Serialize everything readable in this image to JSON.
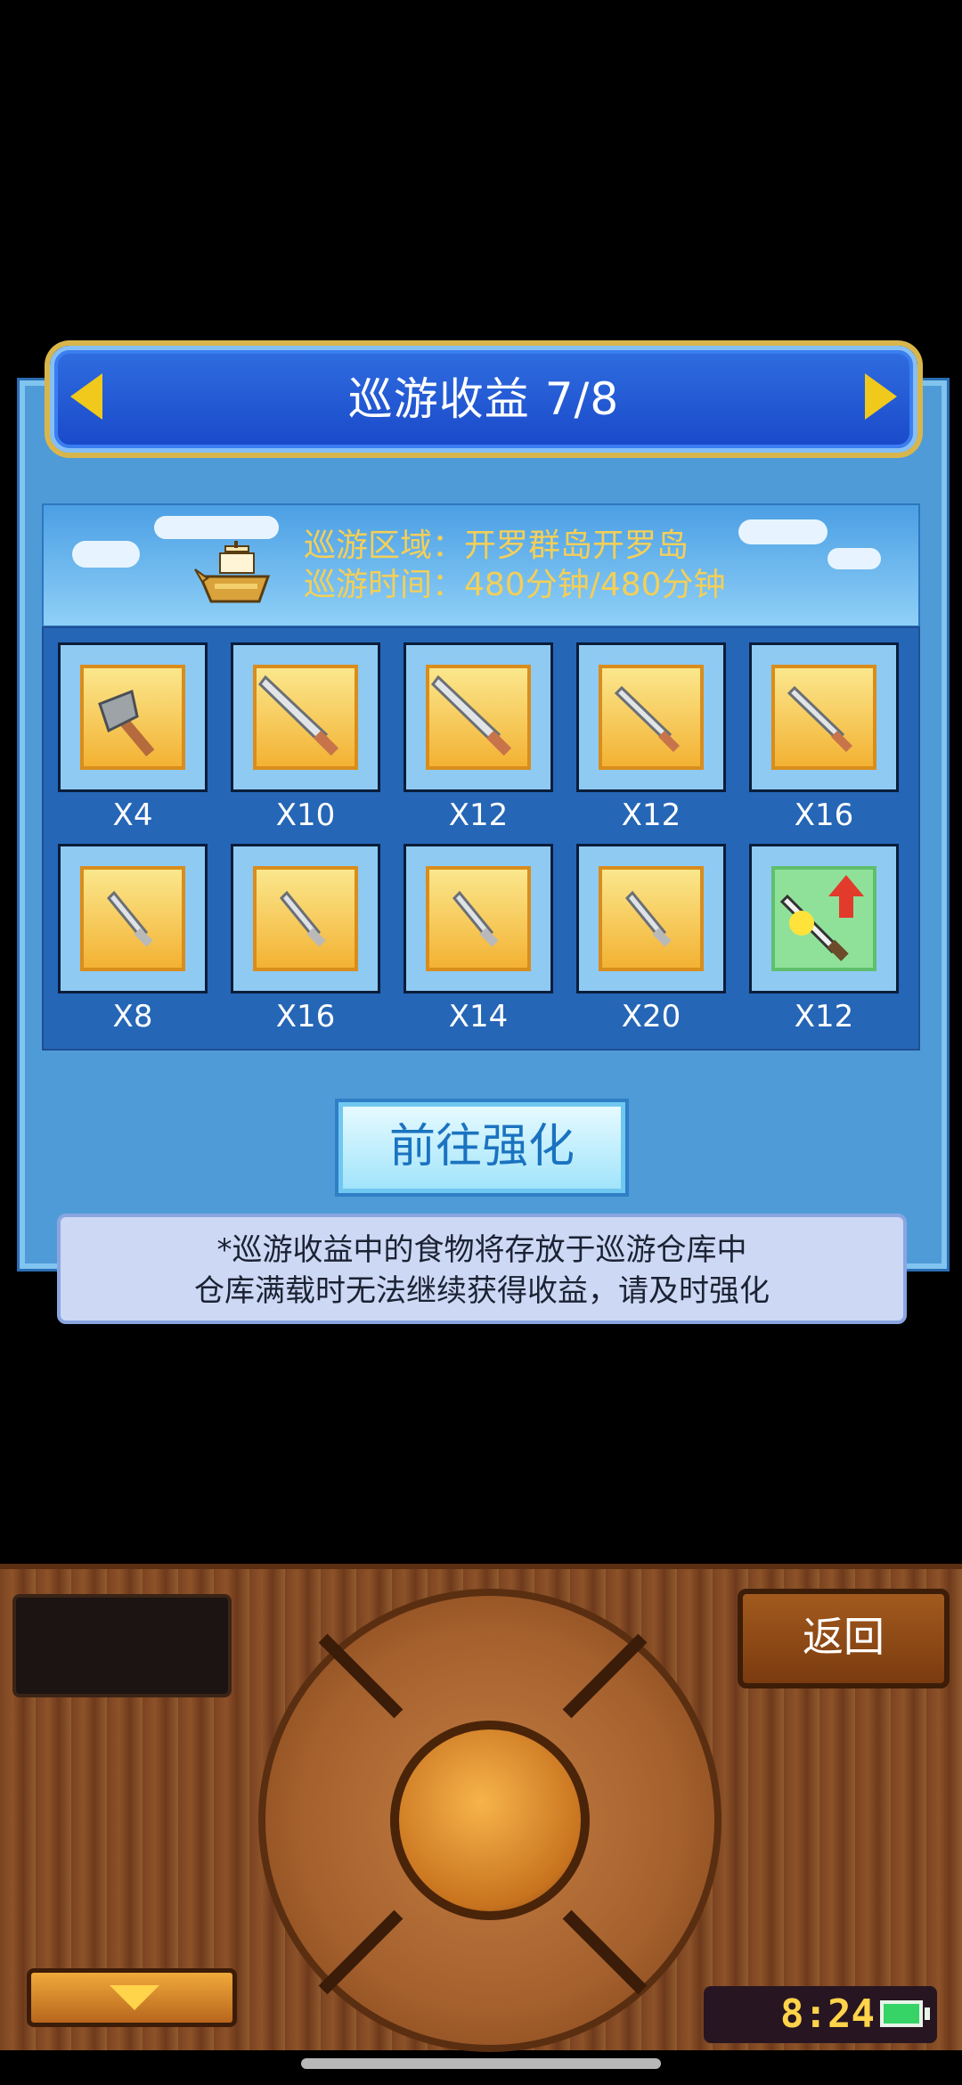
{
  "header": {
    "title": "巡游收益 7/8"
  },
  "region": {
    "line1": "巡游区域：开罗群岛开罗岛",
    "line2": "巡游时间：480分钟/480分钟",
    "icon": "boat-icon"
  },
  "items": [
    {
      "icon": "axe-icon",
      "count": "X4"
    },
    {
      "icon": "broadsword-icon",
      "count": "X10"
    },
    {
      "icon": "broadsword-icon",
      "count": "X12"
    },
    {
      "icon": "sword-icon",
      "count": "X12"
    },
    {
      "icon": "sword-icon",
      "count": "X16"
    },
    {
      "icon": "dagger-icon",
      "count": "X8"
    },
    {
      "icon": "dagger-icon",
      "count": "X16"
    },
    {
      "icon": "dagger-icon",
      "count": "X14"
    },
    {
      "icon": "dagger-icon",
      "count": "X20"
    },
    {
      "icon": "upgrade-sword-icon",
      "count": "X12"
    }
  ],
  "buttons": {
    "upgrade": "前往强化",
    "return": "返回"
  },
  "note": {
    "line1": "*巡游收益中的食物将存放于巡游仓库中",
    "line2": "仓库满载时无法继续获得收益，请及时强化"
  },
  "status": {
    "time": "8:24"
  },
  "colors": {
    "title_bar": "#2f6de0",
    "panel": "#4f9bd8",
    "region_text": "#f4cf58",
    "console_wood": "#8d5228"
  }
}
